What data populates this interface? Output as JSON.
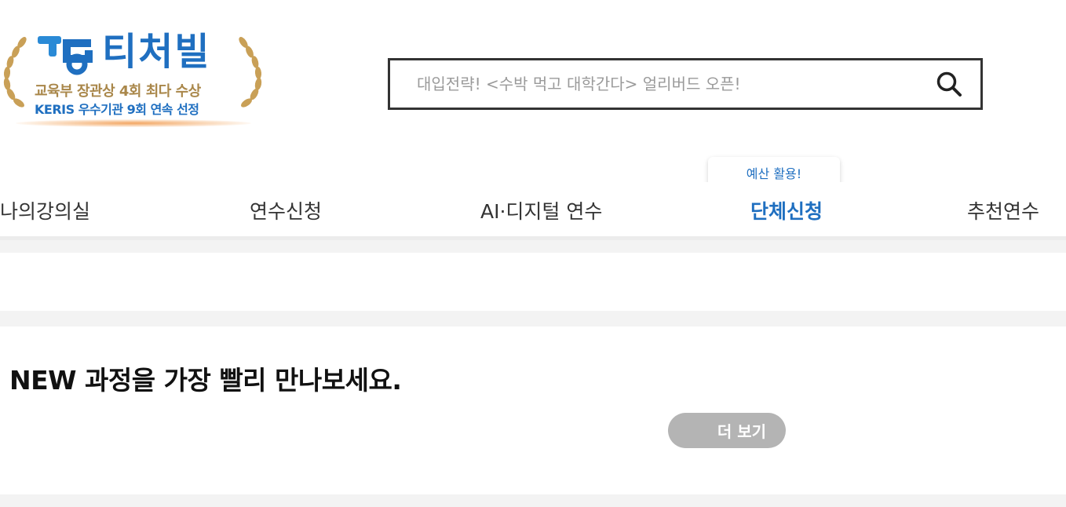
{
  "logo": {
    "brand": "티처빌",
    "award_line1": "교육부 장관상 4회 최다 수상",
    "award_line2": "KERIS 우수기관 9회 연속 선정",
    "brand_color": "#1f6fc0",
    "gold_color": "#a9874a"
  },
  "search": {
    "placeholder": "대입전략! <수박 먹고 대학간다> 얼리버드 오픈!",
    "value": "",
    "icon": "search-icon"
  },
  "nav": {
    "items": [
      {
        "label": "나의강의실",
        "active": false
      },
      {
        "label": "연수신청",
        "active": false
      },
      {
        "label": "AI·디지털 연수",
        "active": false
      },
      {
        "label": "단체신청",
        "active": true
      },
      {
        "label": "추천연수",
        "active": false
      }
    ],
    "tooltip": "예산 활용!",
    "active_color": "#1f6fc0"
  },
  "new_section": {
    "title": "NEW 과정을 가장 빨리 만나보세요.",
    "more_label": "더 보기"
  }
}
